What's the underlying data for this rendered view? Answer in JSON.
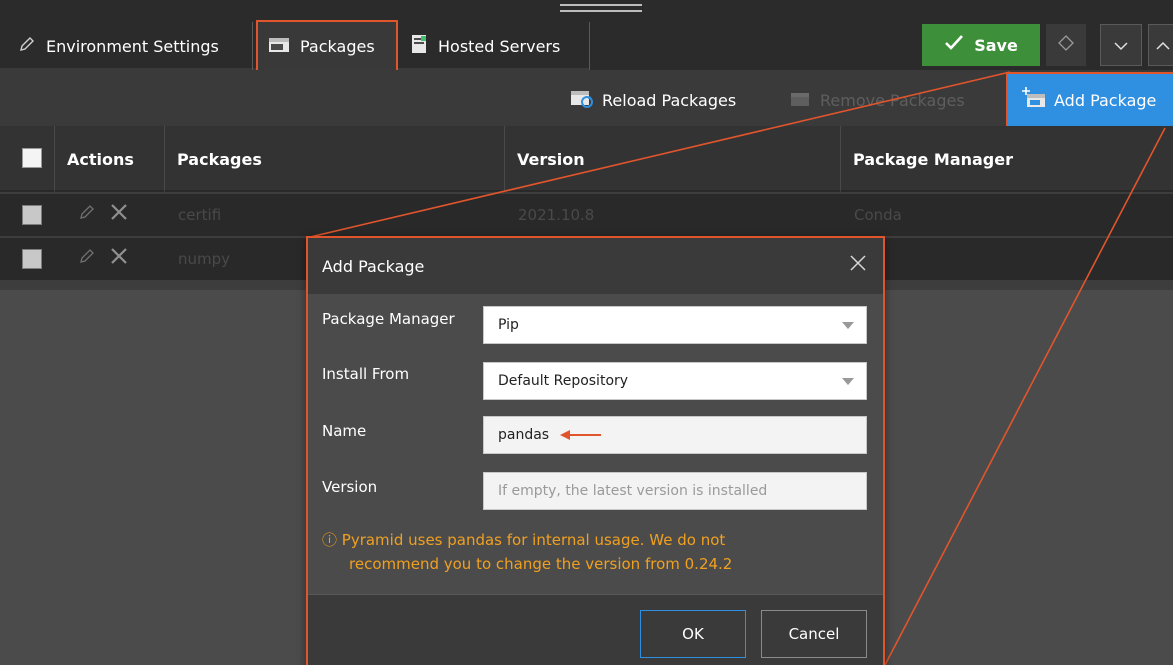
{
  "tabs": [
    {
      "label": "Environment Settings",
      "icon": "pencil-icon"
    },
    {
      "label": "Packages",
      "icon": "package-icon"
    },
    {
      "label": "Hosted Servers",
      "icon": "server-icon"
    }
  ],
  "header_actions": {
    "save_label": "Save"
  },
  "toolbar": {
    "reload_label": "Reload Packages",
    "remove_label": "Remove Packages",
    "add_label": "Add Package"
  },
  "table": {
    "columns": [
      "Actions",
      "Packages",
      "Version",
      "Package Manager"
    ],
    "rows": [
      {
        "package": "certifi",
        "version": "2021.10.8",
        "manager": "Conda"
      },
      {
        "package": "numpy",
        "version": "",
        "manager": ""
      }
    ]
  },
  "dialog": {
    "title": "Add Package",
    "fields": {
      "package_manager": {
        "label": "Package Manager",
        "value": "Pip"
      },
      "install_from": {
        "label": "Install From",
        "value": "Default Repository"
      },
      "name": {
        "label": "Name",
        "value": "pandas"
      },
      "version": {
        "label": "Version",
        "placeholder": "If empty, the latest version is installed"
      }
    },
    "warning_line1": "ⓘ Pyramid uses pandas for internal usage. We do not",
    "warning_line2": "recommend you to change the version from 0.24.2",
    "ok_label": "OK",
    "cancel_label": "Cancel"
  },
  "colors": {
    "highlight": "#e1552c",
    "save_green": "#3d8f3a",
    "primary_blue": "#2f8fe0",
    "warning": "#f0a020"
  }
}
